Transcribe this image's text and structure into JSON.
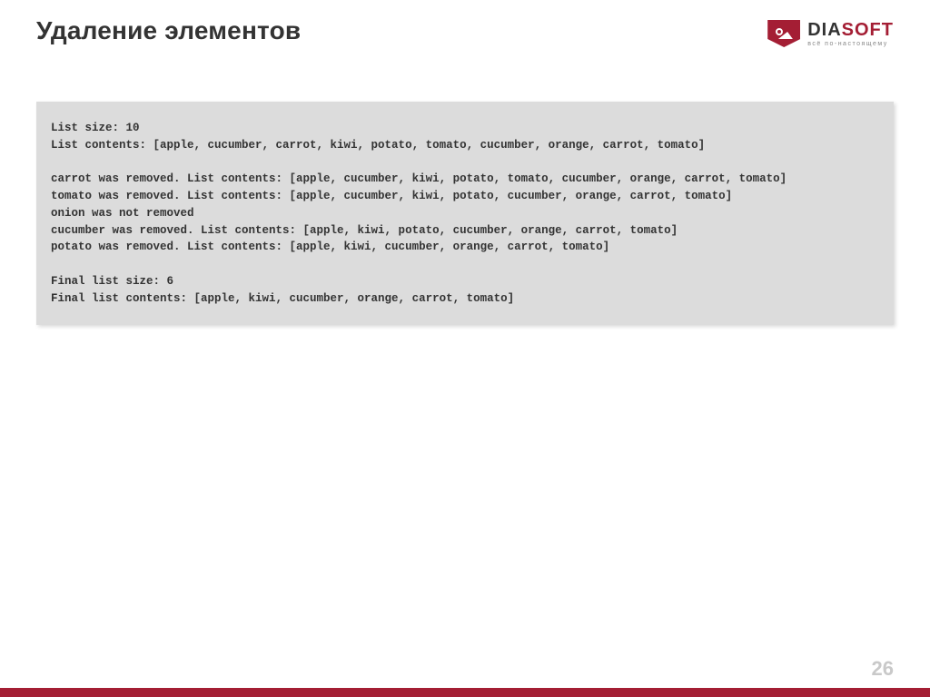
{
  "title": "Удаление элементов",
  "logo": {
    "name_dia": "DIA",
    "name_soft": "SOFT",
    "tagline": "всё по-настоящему"
  },
  "code": "List size: 10\nList contents: [apple, cucumber, carrot, kiwi, potato, tomato, cucumber, orange, carrot, tomato]\n\ncarrot was removed. List contents: [apple, cucumber, kiwi, potato, tomato, cucumber, orange, carrot, tomato]\ntomato was removed. List contents: [apple, cucumber, kiwi, potato, cucumber, orange, carrot, tomato]\nonion was not removed\ncucumber was removed. List contents: [apple, kiwi, potato, cucumber, orange, carrot, tomato]\npotato was removed. List contents: [apple, kiwi, cucumber, orange, carrot, tomato]\n\nFinal list size: 6\nFinal list contents: [apple, kiwi, cucumber, orange, carrot, tomato]",
  "page_number": "26",
  "colors": {
    "brand": "#a41e34",
    "code_bg": "#dcdcdc",
    "text": "#333333",
    "page_num": "#c9c9c9"
  }
}
